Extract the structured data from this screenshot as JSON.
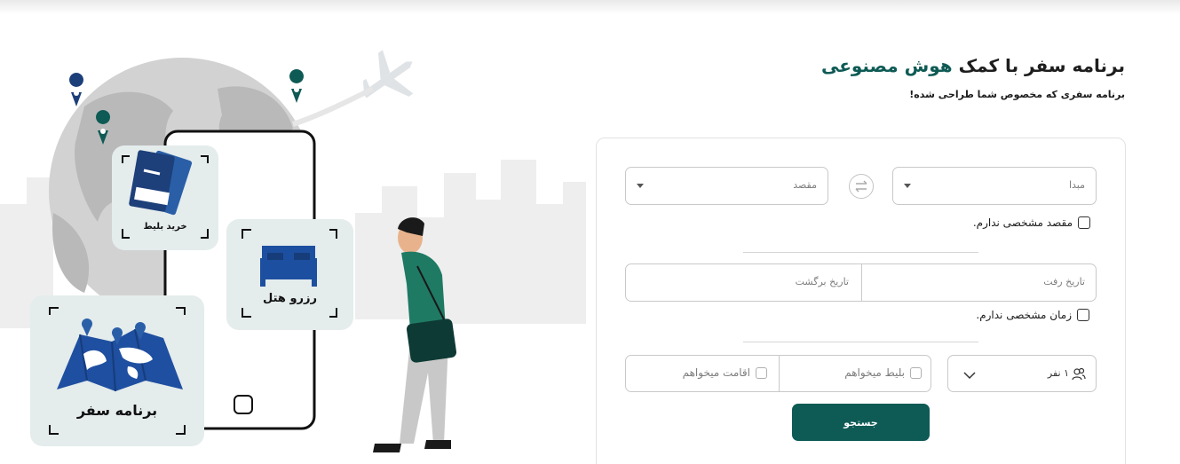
{
  "hero": {
    "title_prefix": "برنامه سفر با کمک",
    "title_accent": "هوش مصنوعی",
    "subtitle": "برنامه سفری که مخصوص شما طراحی شده!"
  },
  "form": {
    "origin_label": "مبدا",
    "destination_label": "مقصد",
    "no_destination": "مقصد مشخصی ندارم.",
    "departure_date": "تاریخ رفت",
    "return_date": "تاریخ برگشت",
    "no_time": "زمان مشخصی ندارم.",
    "want_ticket": "بلیط میخواهم",
    "want_stay": "اقامت میخواهم",
    "travelers": "۱ نفر",
    "search_button": "جستجو"
  },
  "illustration": {
    "tile_ticket": "خرید بلیط",
    "tile_hotel": "رزرو هتل",
    "tile_trip": "برنامه سفر"
  },
  "colors": {
    "accent": "#0e5a55",
    "tile_bg": "#e4ecec",
    "map_blue": "#1f4fa0"
  },
  "icons": [
    "swap-arrows-icon",
    "chevron-down-icon",
    "people-icon",
    "airplane-icon",
    "location-pin-icon",
    "ticket-icon",
    "bed-icon",
    "world-map-icon",
    "phone-home-button-icon"
  ]
}
